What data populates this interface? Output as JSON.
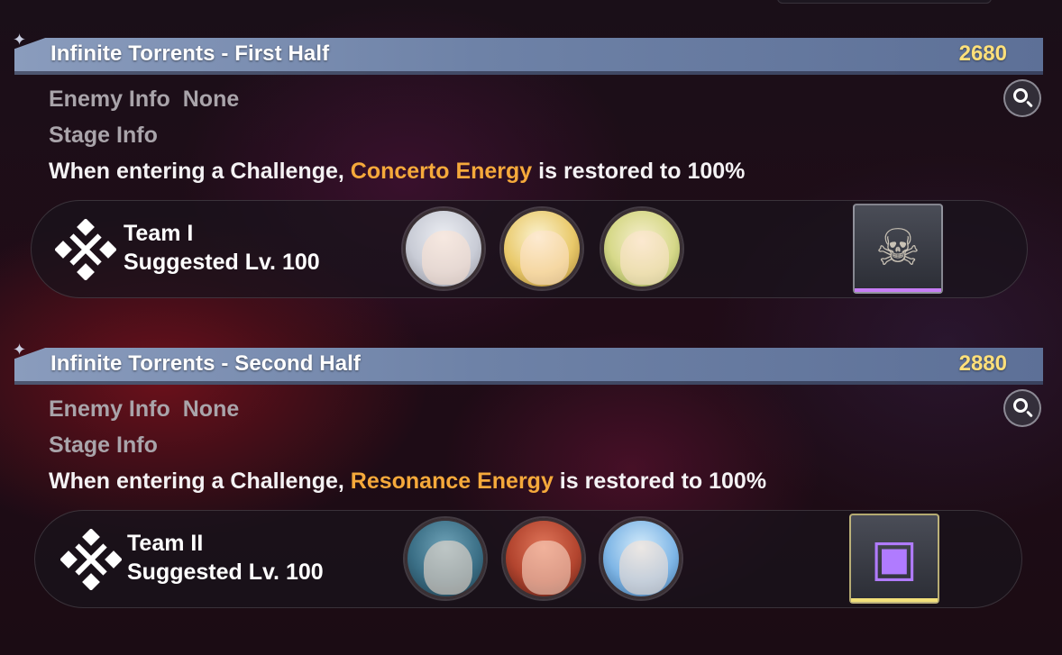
{
  "sections": [
    {
      "title": "Infinite Torrents - First Half",
      "score": "2680",
      "enemy_label": "Enemy Info",
      "enemy_value": "None",
      "stage_label": "Stage Info",
      "desc_pre": "When entering a Challenge, ",
      "desc_highlight": "Concerto Energy",
      "desc_post": " is restored to 100%",
      "team_name": "Team I",
      "team_level": "Suggested Lv. 100",
      "avatars": [
        {
          "icon": "white-haired-character-avatar",
          "bg": "#d9dbe3",
          "hair": "#eceef3"
        },
        {
          "icon": "blonde-character-with-white-hat-avatar",
          "bg": "#e9c96a",
          "hair": "#f2d77e"
        },
        {
          "icon": "blonde-character-with-green-bow-avatar",
          "bg": "#d7e28a",
          "hair": "#e8d58a"
        }
      ],
      "reward": {
        "icon": "skull-bust-trophy-icon",
        "rarity_color": "#c67df5",
        "glyph": "☠"
      }
    },
    {
      "title": "Infinite Torrents - Second Half",
      "score": "2880",
      "enemy_label": "Enemy Info",
      "enemy_value": "None",
      "stage_label": "Stage Info",
      "desc_pre": "When entering a Challenge, ",
      "desc_highlight": "Resonance Energy",
      "desc_post": " is restored to 100%",
      "team_name": "Team II",
      "team_level": "Suggested Lv. 100",
      "avatars": [
        {
          "icon": "blue-haired-character-avatar",
          "bg": "#3b6f86",
          "hair": "#4f8aa3"
        },
        {
          "icon": "red-haired-character-with-glasses-avatar",
          "bg": "#b3452f",
          "hair": "#c9553a"
        },
        {
          "icon": "light-blue-haired-character-avatar",
          "bg": "#7fb6e6",
          "hair": "#a9d3f5"
        }
      ],
      "reward": {
        "icon": "treasure-chest-icon",
        "rarity_color": "#f2e07a",
        "glyph": "▣"
      }
    }
  ],
  "colors": {
    "banner": "#7487ab",
    "score": "#ffe07a",
    "highlight": "#f5a93b",
    "label": "#a9a4aa"
  }
}
